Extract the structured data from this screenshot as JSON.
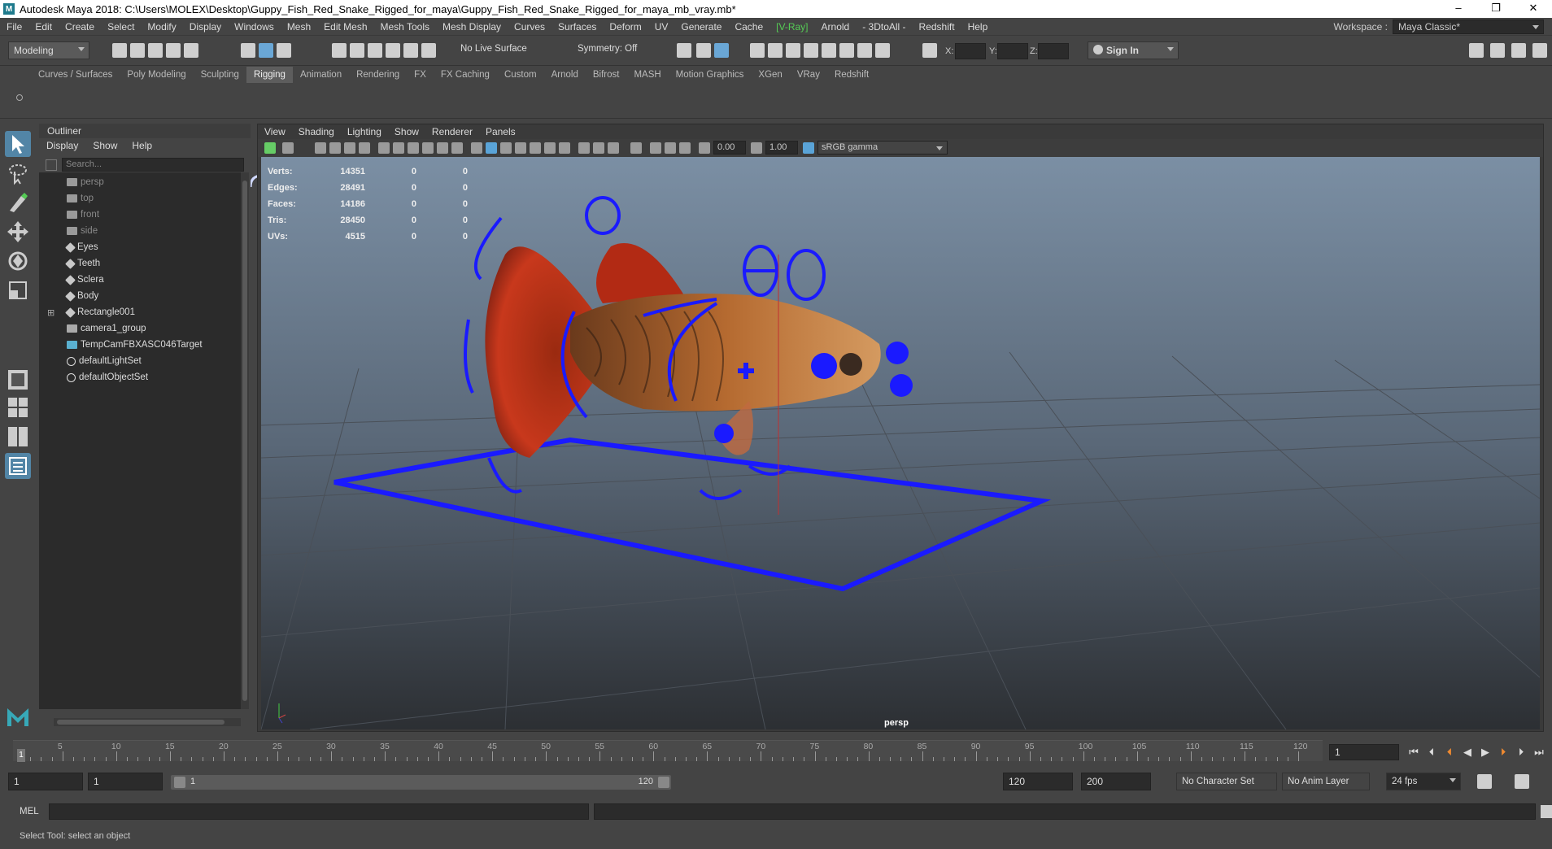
{
  "title": "Autodesk Maya 2018: C:\\Users\\MOLEX\\Desktop\\Guppy_Fish_Red_Snake_Rigged_for_maya\\Guppy_Fish_Red_Snake_Rigged_for_maya_mb_vray.mb*",
  "window_controls": [
    "–",
    "❐",
    "✕"
  ],
  "menus": [
    "File",
    "Edit",
    "Create",
    "Select",
    "Modify",
    "Display",
    "Windows",
    "Mesh",
    "Edit Mesh",
    "Mesh Tools",
    "Mesh Display",
    "Curves",
    "Surfaces",
    "Deform",
    "UV",
    "Generate",
    "Cache",
    "[V-Ray]",
    "Arnold",
    "- 3DtoAll -",
    "Redshift",
    "Help"
  ],
  "workspace": {
    "label": "Workspace :",
    "value": "Maya Classic*"
  },
  "status": {
    "mode": "Modeling",
    "live_surface": "No Live Surface",
    "symmetry": "Symmetry: Off",
    "x_label": "X:",
    "y_label": "Y:",
    "z_label": "Z:",
    "sign_in": "Sign In"
  },
  "shelf_tabs": [
    "Curves / Surfaces",
    "Poly Modeling",
    "Sculpting",
    "Rigging",
    "Animation",
    "Rendering",
    "FX",
    "FX Caching",
    "Custom",
    "Arnold",
    "Bifrost",
    "MASH",
    "Motion Graphics",
    "XGen",
    "VRay",
    "Redshift"
  ],
  "active_shelf": "Rigging",
  "outliner": {
    "title": "Outliner",
    "menu": [
      "Display",
      "Show",
      "Help"
    ],
    "search_placeholder": "Search...",
    "items": [
      {
        "label": "persp",
        "kind": "camera",
        "dim": true
      },
      {
        "label": "top",
        "kind": "camera",
        "dim": true
      },
      {
        "label": "front",
        "kind": "camera",
        "dim": true
      },
      {
        "label": "side",
        "kind": "camera",
        "dim": true
      },
      {
        "label": "Eyes",
        "kind": "mesh",
        "dim": false
      },
      {
        "label": "Teeth",
        "kind": "mesh",
        "dim": false
      },
      {
        "label": "Sclera",
        "kind": "mesh",
        "dim": false
      },
      {
        "label": "Body",
        "kind": "mesh",
        "dim": false
      },
      {
        "label": "Rectangle001",
        "kind": "mesh",
        "dim": false,
        "expandable": true
      },
      {
        "label": "camera1_group",
        "kind": "group",
        "dim": false
      },
      {
        "label": "TempCamFBXASC046Target",
        "kind": "locator",
        "dim": false
      },
      {
        "label": "defaultLightSet",
        "kind": "set",
        "dim": false
      },
      {
        "label": "defaultObjectSet",
        "kind": "set",
        "dim": false
      }
    ]
  },
  "viewport": {
    "menu": [
      "View",
      "Shading",
      "Lighting",
      "Show",
      "Renderer",
      "Panels"
    ],
    "exposure": "0.00",
    "gamma": "1.00",
    "color_space": "sRGB gamma",
    "camera_label": "persp",
    "hud": [
      {
        "label": "Verts:",
        "value": "14351",
        "a": "0",
        "b": "0"
      },
      {
        "label": "Edges:",
        "value": "28491",
        "a": "0",
        "b": "0"
      },
      {
        "label": "Faces:",
        "value": "14186",
        "a": "0",
        "b": "0"
      },
      {
        "label": "Tris:",
        "value": "28450",
        "a": "0",
        "b": "0"
      },
      {
        "label": "UVs:",
        "value": "4515",
        "a": "0",
        "b": "0"
      }
    ]
  },
  "timeline": {
    "ticks": [
      "5",
      "10",
      "15",
      "20",
      "25",
      "30",
      "35",
      "40",
      "45",
      "50",
      "55",
      "60",
      "65",
      "70",
      "75",
      "80",
      "85",
      "90",
      "95",
      "100",
      "105",
      "110",
      "115",
      "120"
    ],
    "current_marker": "1",
    "current_frame": "1",
    "range_start": "1",
    "playback_start": "1",
    "range_slider_start": "1",
    "range_slider_end": "120",
    "playback_end": "120",
    "range_end": "200",
    "character_set": "No Character Set",
    "anim_layer": "No Anim Layer",
    "fps": "24 fps"
  },
  "command": {
    "lang": "MEL",
    "help": "Select Tool: select an object"
  }
}
